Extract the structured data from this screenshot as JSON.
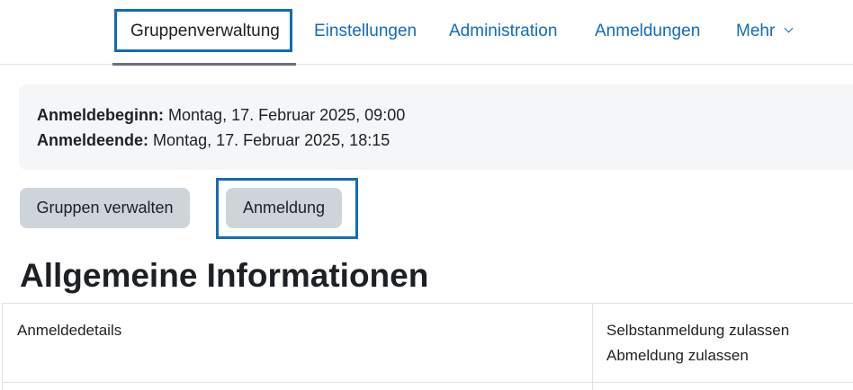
{
  "nav": {
    "items": [
      {
        "label": "Gruppenverwaltung",
        "active": true
      },
      {
        "label": "Einstellungen"
      },
      {
        "label": "Administration"
      },
      {
        "label": "Anmeldungen"
      },
      {
        "label": "Mehr",
        "icon": "chevron-down-icon"
      }
    ]
  },
  "info": {
    "start_label": "Anmeldebeginn:",
    "start_value": "Montag, 17. Februar 2025, 09:00",
    "end_label": "Anmeldeende:",
    "end_value": "Montag, 17. Februar 2025, 18:15"
  },
  "actions": {
    "manage_groups": "Gruppen verwalten",
    "registration": "Anmeldung"
  },
  "section": {
    "title": "Allgemeine Informationen"
  },
  "table": {
    "rows": [
      {
        "label": "Anmeldedetails",
        "values": [
          "Selbstanmeldung zulassen",
          "Abmeldung zulassen"
        ]
      }
    ]
  },
  "colors": {
    "link": "#0f6cbf",
    "focus": "#0f6cbf",
    "button_bg": "#ced4da",
    "info_bg": "#f5f6f7",
    "text": "#1d2125"
  }
}
